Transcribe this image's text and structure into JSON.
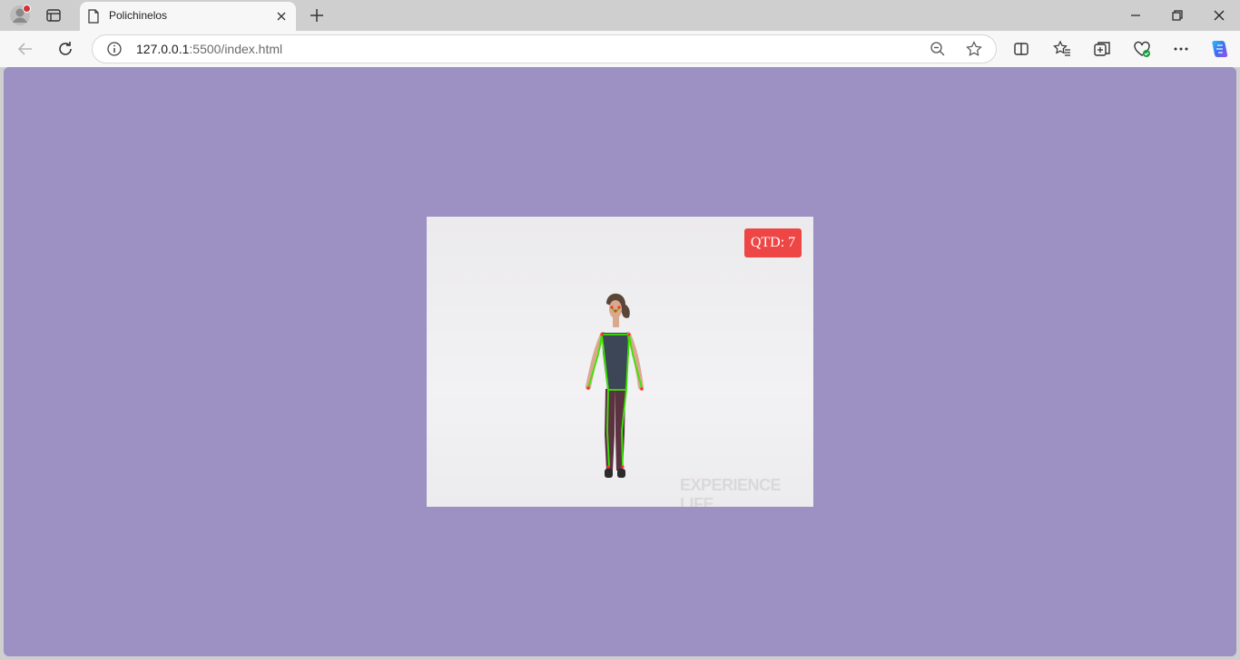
{
  "browser": {
    "tab_title": "Polichinelos",
    "url_host": "127.0.0.1",
    "url_rest": ":5500/index.html"
  },
  "page": {
    "background_color": "#9d90c3",
    "counter_label": "QTD: 7",
    "counter_color": "#ee4545",
    "watermark": "EXPERIENCE LIFE",
    "pose_overlay_color": "#39e600"
  }
}
